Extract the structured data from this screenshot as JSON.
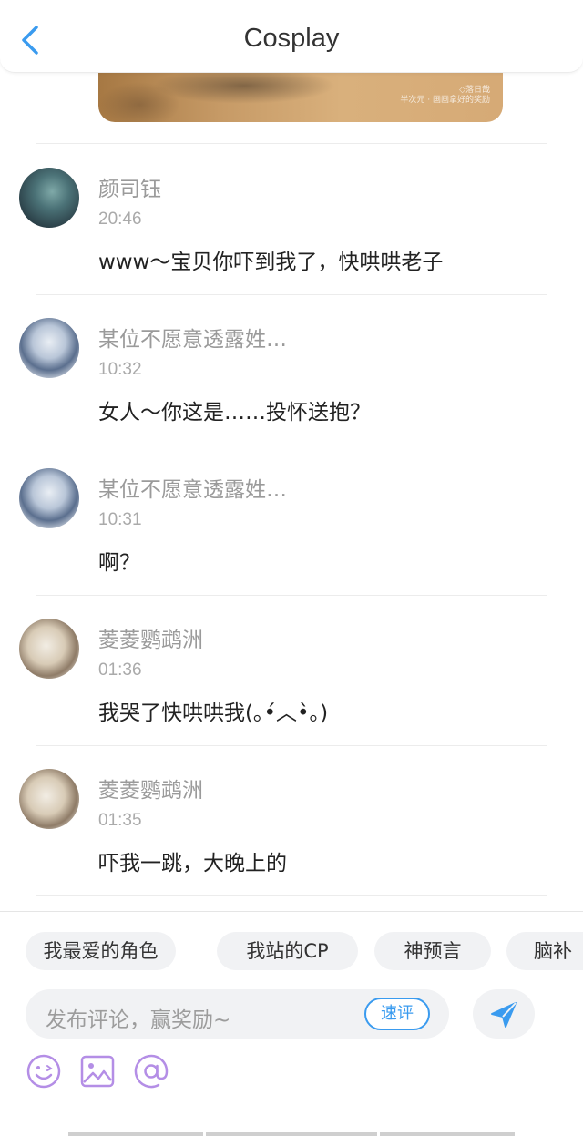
{
  "header": {
    "title": "Cosplay"
  },
  "post": {
    "watermark_line1": "◇落日哉",
    "watermark_line2": "半次元 · 画画拿好的奖励"
  },
  "comments": [
    {
      "name": "颜司钰",
      "time": "20:46",
      "text": "www～宝贝你吓到我了，快哄哄老子"
    },
    {
      "name": "某位不愿意透露姓…",
      "time": "10:32",
      "text": "女人～你这是……投怀送抱？"
    },
    {
      "name": "某位不愿意透露姓…",
      "time": "10:31",
      "text": "啊？"
    },
    {
      "name": "菱菱鹦鹉洲",
      "time": "01:36",
      "text": "我哭了快哄哄我(｡•́︿•̀｡)"
    },
    {
      "name": "菱菱鹦鹉洲",
      "time": "01:35",
      "text": "吓我一跳，大晚上的"
    }
  ],
  "chips": [
    "我最爱的角色",
    "我站的CP",
    "神预言",
    "脑补"
  ],
  "input": {
    "placeholder": "发布评论，赢奖励~",
    "quick_label": "速评"
  },
  "colors": {
    "accent": "#3a9bef",
    "tool_icon": "#b48ee6"
  },
  "icons": [
    "back-arrow-icon",
    "send-icon",
    "emoji-icon",
    "image-icon",
    "at-icon"
  ]
}
